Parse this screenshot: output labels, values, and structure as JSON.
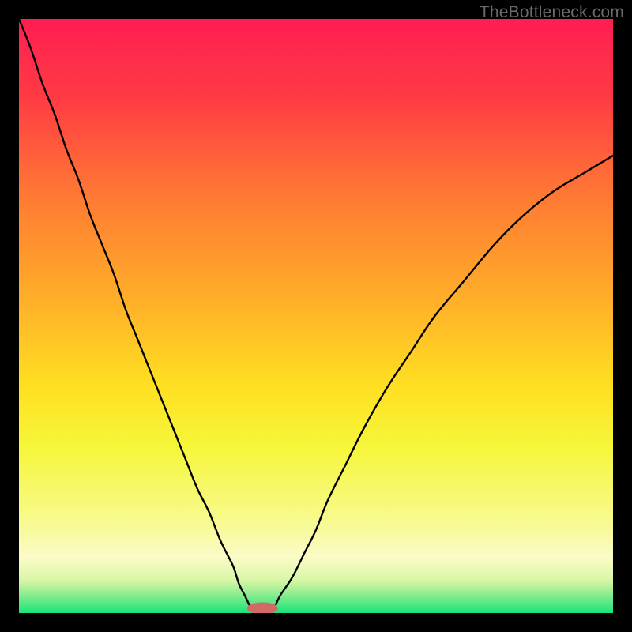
{
  "watermark": "TheBottleneck.com",
  "colors": {
    "frame": "#000000",
    "gradient_stops": [
      {
        "offset": 0.0,
        "color": "#ff1e52"
      },
      {
        "offset": 0.13,
        "color": "#ff3a44"
      },
      {
        "offset": 0.3,
        "color": "#ff7a33"
      },
      {
        "offset": 0.48,
        "color": "#ffb128"
      },
      {
        "offset": 0.62,
        "color": "#ffe021"
      },
      {
        "offset": 0.72,
        "color": "#f6f63a"
      },
      {
        "offset": 0.84,
        "color": "#f7fa8a"
      },
      {
        "offset": 0.905,
        "color": "#fbfbc7"
      },
      {
        "offset": 0.945,
        "color": "#d8f7a6"
      },
      {
        "offset": 0.97,
        "color": "#88ec8e"
      },
      {
        "offset": 1.0,
        "color": "#17e47a"
      }
    ],
    "curve": "#000000",
    "marker_fill": "#cf6a67",
    "marker_stroke": "#cf6a67"
  },
  "chart_data": {
    "type": "line",
    "title": "",
    "xlabel": "",
    "ylabel": "",
    "xlim": [
      0,
      100
    ],
    "ylim": [
      0,
      100
    ],
    "series": [
      {
        "name": "left-branch",
        "x": [
          0,
          2,
          4,
          6,
          8,
          10,
          12,
          14,
          16,
          18,
          20,
          22,
          24,
          26,
          28,
          30,
          32,
          34,
          36,
          37,
          38,
          39,
          40
        ],
        "values": [
          100,
          95,
          89,
          84,
          78,
          73,
          67,
          62,
          57,
          51,
          46,
          41,
          36,
          31,
          26,
          21,
          17,
          12,
          8,
          5,
          3,
          1,
          0
        ]
      },
      {
        "name": "right-branch",
        "x": [
          42,
          43,
          44,
          46,
          48,
          50,
          52,
          55,
          58,
          62,
          66,
          70,
          75,
          80,
          85,
          90,
          95,
          100
        ],
        "values": [
          0,
          1,
          3,
          6,
          10,
          14,
          19,
          25,
          31,
          38,
          44,
          50,
          56,
          62,
          67,
          71,
          74,
          77
        ]
      }
    ],
    "marker": {
      "x": 41,
      "y": 0,
      "rx": 2.6,
      "ry": 1.0
    }
  }
}
